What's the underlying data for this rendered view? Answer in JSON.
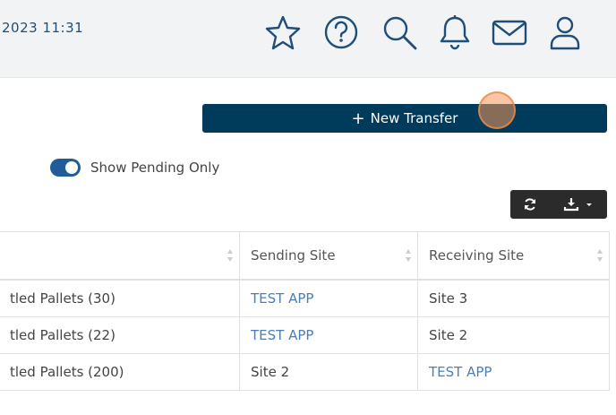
{
  "header": {
    "datetime": "2023 11:31",
    "icons": [
      "star-icon",
      "help-icon",
      "search-icon",
      "bell-icon",
      "mail-icon",
      "user-icon"
    ]
  },
  "actions": {
    "new_transfer_label": "New Transfer",
    "plus": "+"
  },
  "filters": {
    "show_pending_label": "Show Pending Only",
    "show_pending_on": true
  },
  "toolbar": {
    "refresh_icon": "refresh-icon",
    "download_icon": "download-icon"
  },
  "table": {
    "headers": [
      "",
      "Sending Site",
      "Receiving Site"
    ],
    "rows": [
      {
        "col1": "tled Pallets (30)",
        "sending": "TEST APP",
        "receiving": "Site 3"
      },
      {
        "col1": "tled Pallets (22)",
        "sending": "TEST APP",
        "receiving": "Site 2"
      },
      {
        "col1": "tled Pallets (200)",
        "sending": "Site 2",
        "receiving": "TEST APP"
      }
    ]
  },
  "colors": {
    "primary": "#003b5c",
    "toggle": "#1f5c99",
    "link": "#4a7fb5",
    "toolbar": "#2b2b2b"
  }
}
